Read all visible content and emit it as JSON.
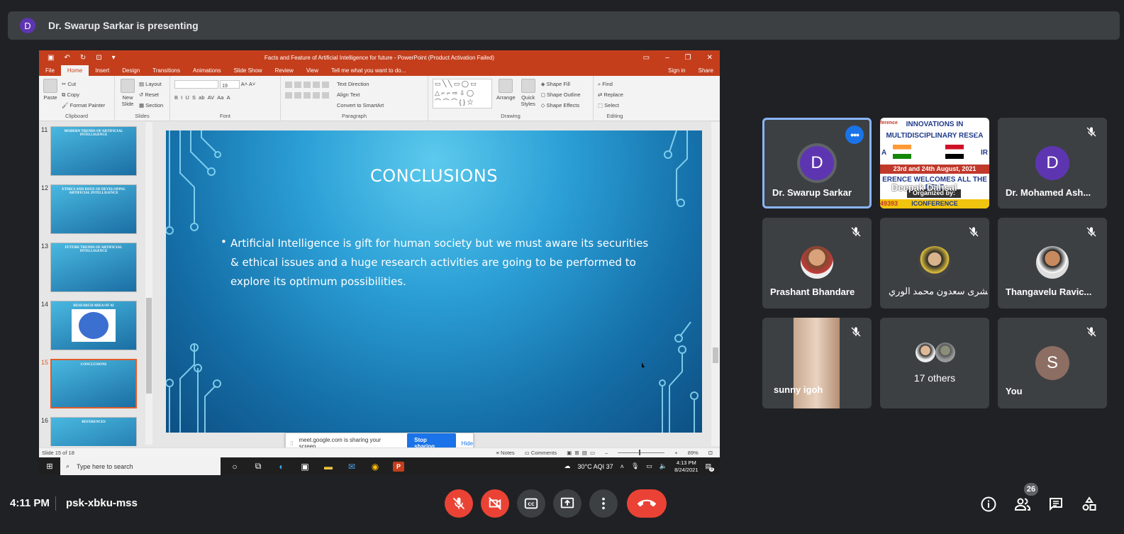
{
  "presenting": {
    "avatar_letter": "D",
    "text": "Dr. Swarup Sarkar is presenting"
  },
  "powerpoint": {
    "window_title": "Facts and Feature of Artificial Intelligence for future  -  PowerPoint (Product Activation Failed)",
    "tabs": [
      "File",
      "Home",
      "Insert",
      "Design",
      "Transitions",
      "Animations",
      "Slide Show",
      "Review",
      "View"
    ],
    "tell_me": "Tell me what you want to do...",
    "sign_in": "Sign in",
    "share": "Share",
    "ribbon": {
      "clipboard": {
        "paste": "Paste",
        "cut": "Cut",
        "copy": "Copy",
        "format_painter": "Format Painter",
        "group": "Clipboard"
      },
      "slides": {
        "new_slide": "New Slide",
        "layout": "Layout",
        "reset": "Reset",
        "section": "Section",
        "group": "Slides"
      },
      "font": {
        "size": "19",
        "group": "Font"
      },
      "paragraph": {
        "text_direction": "Text Direction",
        "align_text": "Align Text",
        "convert": "Convert to SmartArt",
        "group": "Paragraph"
      },
      "drawing": {
        "arrange": "Arrange",
        "quick_styles": "Quick Styles",
        "shape_fill": "Shape Fill",
        "shape_outline": "Shape Outline",
        "shape_effects": "Shape Effects",
        "group": "Drawing"
      },
      "editing": {
        "find": "Find",
        "replace": "Replace",
        "select": "Select",
        "group": "Editing"
      }
    },
    "thumbnails": [
      {
        "num": "11",
        "title": "MODERN TRENDS OF ARTIFICIAL INTELLIGENCE"
      },
      {
        "num": "12",
        "title": "ETHICS AND ISSUE OF DEVELOPING ARTIFICIAL INTELLIGENCE"
      },
      {
        "num": "13",
        "title": "FUTURE TRENDS OF ARTIFICIAL INTELLIGENCE"
      },
      {
        "num": "14",
        "title": "RESEARCH AREA OF AI"
      },
      {
        "num": "15",
        "title": "CONCLUSIONS"
      },
      {
        "num": "16",
        "title": "REFERENCES"
      }
    ],
    "slide": {
      "title": "CONCLUSIONS",
      "bullet": "Artificial Intelligence is gift for human society but we must aware its securities & ethical issues  and a huge research activities are going to be performed to explore its optimum possibilities."
    },
    "share_notification": {
      "message": "meet.google.com is sharing your screen.",
      "stop": "Stop sharing",
      "hide": "Hide"
    },
    "status": {
      "slide_of": "Slide 15 of 18",
      "notes": "Notes",
      "comments": "Comments",
      "zoom": "89%"
    },
    "taskbar": {
      "search_placeholder": "Type here to search",
      "weather": "30°C  AQI 37",
      "time": "4:13 PM",
      "date": "8/24/2021",
      "notif_count": "3"
    }
  },
  "participants": [
    {
      "name": "Dr. Swarup Sarkar",
      "letter": "D",
      "speaking": true
    },
    {
      "name": "Deepak Dahsal"
    },
    {
      "name": "Dr. Mohamed Ash...",
      "letter": "D"
    },
    {
      "name": "Prashant Bhandare"
    },
    {
      "name": "بشرى سعدون محمد الوري"
    },
    {
      "name": "Thangavelu Ravic..."
    },
    {
      "name": "sunny igoh"
    },
    {
      "name": "17 others"
    },
    {
      "name": "You",
      "letter": "S"
    }
  ],
  "banner": {
    "line1": "INNOVATIONS IN",
    "line2": "MULTIDISCIPLINARY RESEA",
    "date": "23rd and 24th August, 2021",
    "welcome": "ERENCE WELCOMES ALL THE DELE",
    "organized": "Organized by:",
    "bottom": "ICONFERENCE",
    "left_a": "A",
    "right_ir": "IR",
    "id": "49393",
    "top_left": "ference"
  },
  "meeting": {
    "time": "4:11 PM",
    "code": "psk-xbku-mss",
    "people_count": "26"
  },
  "colors": {
    "accent": "#1a73e8",
    "danger": "#ea4335",
    "tile_bg": "#3c4043",
    "page_bg": "#202124",
    "ppt_orange": "#c43e1c"
  }
}
